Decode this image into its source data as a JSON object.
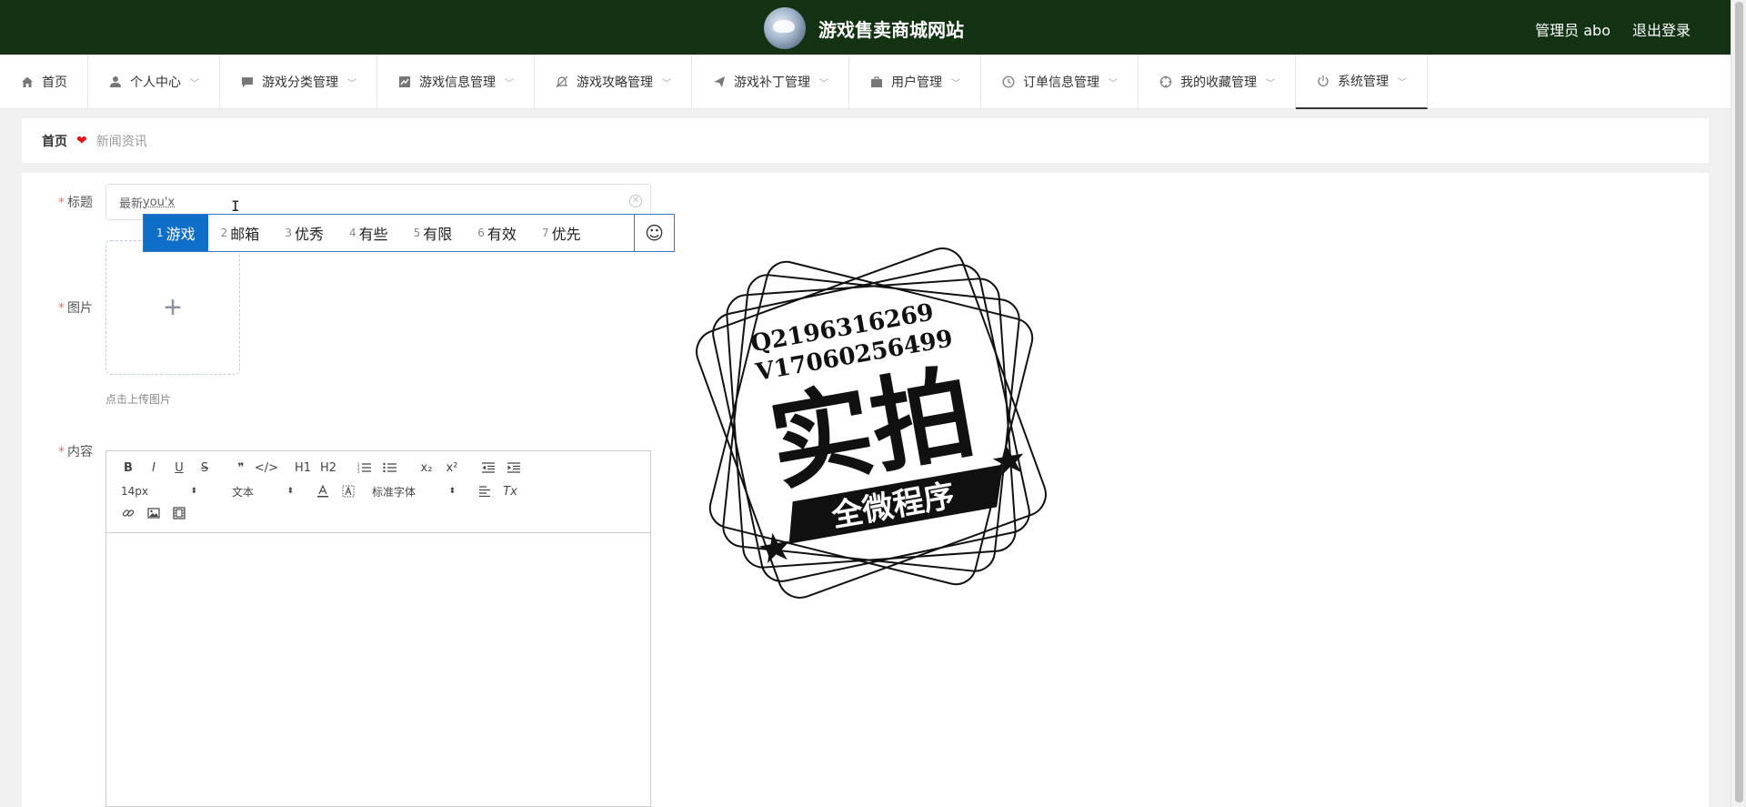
{
  "header": {
    "site_title": "游戏售卖商城网站",
    "user_label": "管理员 abo",
    "logout_label": "退出登录"
  },
  "nav": {
    "items": [
      {
        "label": "首页",
        "icon": "home-icon"
      },
      {
        "label": "个人中心",
        "icon": "user-icon"
      },
      {
        "label": "游戏分类管理",
        "icon": "chat-icon"
      },
      {
        "label": "游戏信息管理",
        "icon": "chart-icon"
      },
      {
        "label": "游戏攻略管理",
        "icon": "bell-off-icon"
      },
      {
        "label": "游戏补丁管理",
        "icon": "send-icon"
      },
      {
        "label": "用户管理",
        "icon": "briefcase-icon"
      },
      {
        "label": "订单信息管理",
        "icon": "clock-icon"
      },
      {
        "label": "我的收藏管理",
        "icon": "crosshair-icon"
      },
      {
        "label": "系统管理",
        "icon": "power-icon"
      }
    ],
    "active": "系统管理"
  },
  "breadcrumb": {
    "home": "首页",
    "current": "新闻资讯"
  },
  "form": {
    "title_label": "标题",
    "title_value_prefix": "最新",
    "title_value_composing": "you'x",
    "image_label": "图片",
    "upload_plus": "+",
    "upload_tip": "点击上传图片",
    "content_label": "内容"
  },
  "ime": {
    "candidates": [
      {
        "num": "1",
        "text": "游戏"
      },
      {
        "num": "2",
        "text": "邮箱"
      },
      {
        "num": "3",
        "text": "优秀"
      },
      {
        "num": "4",
        "text": "有些"
      },
      {
        "num": "5",
        "text": "有限"
      },
      {
        "num": "6",
        "text": "有效"
      },
      {
        "num": "7",
        "text": "优先"
      }
    ],
    "emoji": "☺"
  },
  "editor": {
    "font_size": "14px",
    "header_select": "文本",
    "font_family": "标准字体",
    "buttons": {
      "bold": "B",
      "italic": "I",
      "underline": "U",
      "strike": "S",
      "blockquote": "❞",
      "code": "</>",
      "h1": "H1",
      "h2": "H2",
      "sub": "x₂",
      "sup": "x²",
      "clean": "Tx"
    }
  },
  "watermark": {
    "line1": "Q2196316269",
    "line2": "V1706025649​9",
    "big": "实拍",
    "ribbon": "全微程序"
  },
  "colors": {
    "header_bg": "#143314",
    "ime_selected": "#0f6ec8",
    "required_star": "#f56c6c",
    "heart": "#e31818"
  }
}
